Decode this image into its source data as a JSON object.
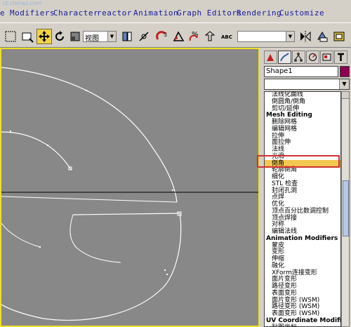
{
  "watermark": "ct.chinaz.com",
  "menu": {
    "items": [
      "e",
      "Modifiers",
      "Character",
      "reactor",
      "Animation",
      "Graph Editors",
      "Rendering",
      "Customize"
    ]
  },
  "toolbar": {
    "view_combo": "视图",
    "selection_combo": ""
  },
  "command_panel": {
    "object_name": "Shape1",
    "object_color": "#8a0050",
    "modifier_list": {
      "items": [
        {
          "label": "法线化曲线",
          "type": "item"
        },
        {
          "label": "倒圆角/倒角",
          "type": "item"
        },
        {
          "label": "剪切/延伸",
          "type": "item"
        },
        {
          "label": "Mesh Editing",
          "type": "header"
        },
        {
          "label": "删除网格",
          "type": "item"
        },
        {
          "label": "编辑网格",
          "type": "item"
        },
        {
          "label": "拉伸",
          "type": "item"
        },
        {
          "label": "面拉伸",
          "type": "item"
        },
        {
          "label": "法线",
          "type": "item"
        },
        {
          "label": "光滑",
          "type": "item"
        },
        {
          "label": "倒角",
          "type": "item",
          "selected": true
        },
        {
          "label": "轮廓倒角",
          "type": "item"
        },
        {
          "label": "细化",
          "type": "item"
        },
        {
          "label": "STL 检查",
          "type": "item"
        },
        {
          "label": "封闭孔洞",
          "type": "item"
        },
        {
          "label": "点焊",
          "type": "item"
        },
        {
          "label": "优化",
          "type": "item"
        },
        {
          "label": "顶点百分比数调控制",
          "type": "item"
        },
        {
          "label": "顶点焊接",
          "type": "item"
        },
        {
          "label": "对称",
          "type": "item"
        },
        {
          "label": "编辑法线",
          "type": "item"
        },
        {
          "label": "Animation Modifiers",
          "type": "header"
        },
        {
          "label": "蒙皮",
          "type": "item"
        },
        {
          "label": "变形",
          "type": "item"
        },
        {
          "label": "伸缩",
          "type": "item"
        },
        {
          "label": "融化",
          "type": "item"
        },
        {
          "label": "XForm连接变形",
          "type": "item"
        },
        {
          "label": "面片变形",
          "type": "item"
        },
        {
          "label": "路径变形",
          "type": "item"
        },
        {
          "label": "表面变形",
          "type": "item"
        },
        {
          "label": "面片变形 (WSM)",
          "type": "item"
        },
        {
          "label": "路径变形 (WSM)",
          "type": "item"
        },
        {
          "label": "表面变形 (WSM)",
          "type": "item"
        },
        {
          "label": "UV Coordinate Modifiers",
          "type": "header"
        },
        {
          "label": "贴图坐标",
          "type": "item"
        }
      ]
    }
  },
  "colors": {
    "viewport_bg": "#888888",
    "active_border": "#f0e020",
    "selection": "#f4c850",
    "highlight_box": "#d03030",
    "spline": "#ffffff"
  },
  "icons": [
    "select-icon",
    "move-icon",
    "rotate-icon",
    "scale-icon",
    "snap-icon",
    "angle-snap-icon",
    "percent-snap-icon",
    "mirror-icon",
    "align-icon",
    "material-icon",
    "render-icon",
    "create-tab-icon",
    "modify-tab-icon",
    "hierarchy-tab-icon",
    "motion-tab-icon",
    "display-tab-icon",
    "utilities-tab-icon"
  ]
}
